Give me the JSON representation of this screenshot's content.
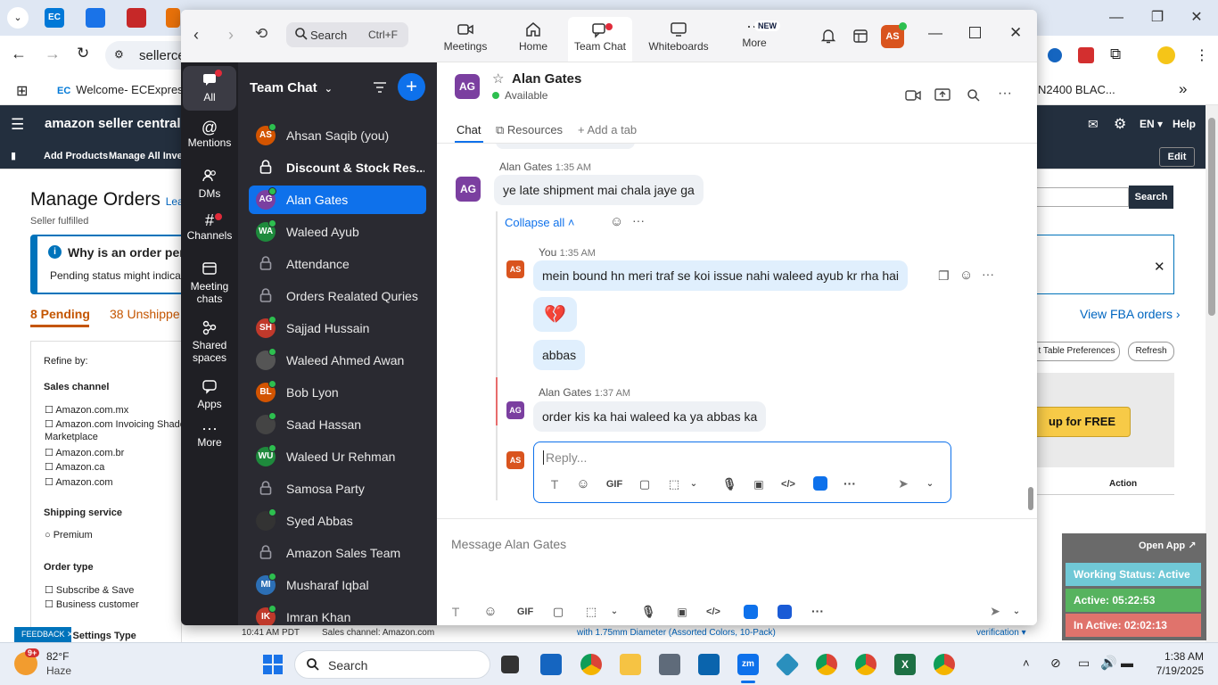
{
  "browser": {
    "address": "sellerce",
    "bookmark_label": "Welcome- ECExpres...",
    "bookmark_right": "N2400 BLAC..."
  },
  "amazon": {
    "brand": "amazon seller central",
    "nav": [
      "Add Products",
      "Manage All Invent"
    ],
    "lang": "EN",
    "help": "Help",
    "edit": "Edit",
    "page_title": "Manage Orders",
    "learn": "Lear",
    "subtitle": "Seller fulfilled",
    "info_title": "Why is an order pen",
    "info_body": "Pending status might indicate a",
    "tab_pending": "8 Pending",
    "tab_unshipped": "38 Unshippe",
    "refine": "Refine by:",
    "sales_channel": "Sales channel",
    "channels": [
      "Amazon.com.mx",
      "Amazon.com Invoicing Shado",
      "Marketplace",
      "Amazon.com.br",
      "Amazon.ca",
      "Amazon.com"
    ],
    "shipping_service": "Shipping service",
    "premium": "Premium",
    "order_type": "Order type",
    "order_types": [
      "Subscribe & Save",
      "Business customer"
    ],
    "settings_type": "ng Settings Type",
    "search_btn": "Search",
    "view_fba": "View FBA orders ›",
    "table_prefs": "t Table Preferences",
    "refresh": "Refresh",
    "signup": "up for FREE",
    "action_col": "Action",
    "footer_time": "10:41 AM PDT",
    "footer_channel": "Sales channel: Amazon.com",
    "footer_product": "with 1.75mm Diameter (Assorted Colors, 10-Pack)",
    "footer_verify": "verification",
    "feedback": "FEEDBACK"
  },
  "zoom": {
    "search_label": "Search",
    "search_shortcut": "Ctrl+F",
    "nav": {
      "meetings": "Meetings",
      "home": "Home",
      "team_chat": "Team Chat",
      "whiteboards": "Whiteboards",
      "more": "More",
      "new_badge": "NEW"
    },
    "user_initials": "AS",
    "rail": {
      "all": "All",
      "mentions": "Mentions",
      "dms": "DMs",
      "channels": "Channels",
      "meeting_chats_1": "Meeting",
      "meeting_chats_2": "chats",
      "shared_1": "Shared",
      "shared_2": "spaces",
      "apps": "Apps",
      "more": "More"
    },
    "list_title": "Team Chat",
    "chats": [
      {
        "initials": "AS",
        "name": "Ahsan Saqib (you)",
        "color": "#d35400"
      },
      {
        "initials": "",
        "name": "Discount & Stock Res...",
        "color": ""
      },
      {
        "initials": "AG",
        "name": "Alan Gates",
        "color": "#7b3fa0"
      },
      {
        "initials": "WA",
        "name": "Waleed Ayub",
        "color": "#1e8a3c"
      },
      {
        "initials": "",
        "name": "Attendance",
        "color": ""
      },
      {
        "initials": "",
        "name": "Orders Realated Quries",
        "color": ""
      },
      {
        "initials": "SH",
        "name": "Sajjad Hussain",
        "color": "#c0392b"
      },
      {
        "initials": "",
        "name": "Waleed Ahmed Awan",
        "color": "#555"
      },
      {
        "initials": "BL",
        "name": "Bob Lyon",
        "color": "#d35400"
      },
      {
        "initials": "",
        "name": "Saad Hassan",
        "color": "#444"
      },
      {
        "initials": "WU",
        "name": "Waleed Ur Rehman",
        "color": "#1e8a3c"
      },
      {
        "initials": "",
        "name": "Samosa Party",
        "color": ""
      },
      {
        "initials": "",
        "name": "Syed Abbas",
        "color": "#333"
      },
      {
        "initials": "",
        "name": "Amazon Sales Team",
        "color": ""
      },
      {
        "initials": "MI",
        "name": "Musharaf Iqbal",
        "color": "#2c6fb5"
      },
      {
        "initials": "IK",
        "name": "Imran Khan",
        "color": "#c0392b"
      }
    ],
    "conversation": {
      "initials": "AG",
      "name": "Alan Gates",
      "status": "Available",
      "tabs": [
        "Chat",
        "Resources",
        "Add a tab"
      ],
      "messages": {
        "m1_sender": "Alan Gates",
        "m1_time": "1:35 AM",
        "m1_text": "ye late shipment mai chala jaye ga",
        "collapse": "Collapse all",
        "m2_sender": "You",
        "m2_time": "1:35 AM",
        "m2_text": "mein bound hn meri traf se koi issue nahi waleed ayub kr rha hai",
        "m2_emoji": "💔",
        "m2_text2": "abbas",
        "m3_sender": "Alan Gates",
        "m3_time": "1:37 AM",
        "m3_text": "order kis ka hai waleed ka ya abbas ka",
        "reply_placeholder": "Reply...",
        "composer_placeholder": "Message Alan Gates",
        "gif": "GIF"
      }
    }
  },
  "working_status": {
    "open_app": "Open App ↗",
    "status": "Working Status: Active",
    "active": "Active: 05:22:53",
    "inactive": "In Active: 02:02:13",
    "colors": {
      "status": "#70c8d6",
      "active": "#57b35f",
      "inactive": "#e0736c"
    }
  },
  "taskbar": {
    "temp": "82°F",
    "weather": "Haze",
    "weather_badge": "9+",
    "search": "Search",
    "time": "1:38 AM",
    "date": "7/19/2025"
  }
}
